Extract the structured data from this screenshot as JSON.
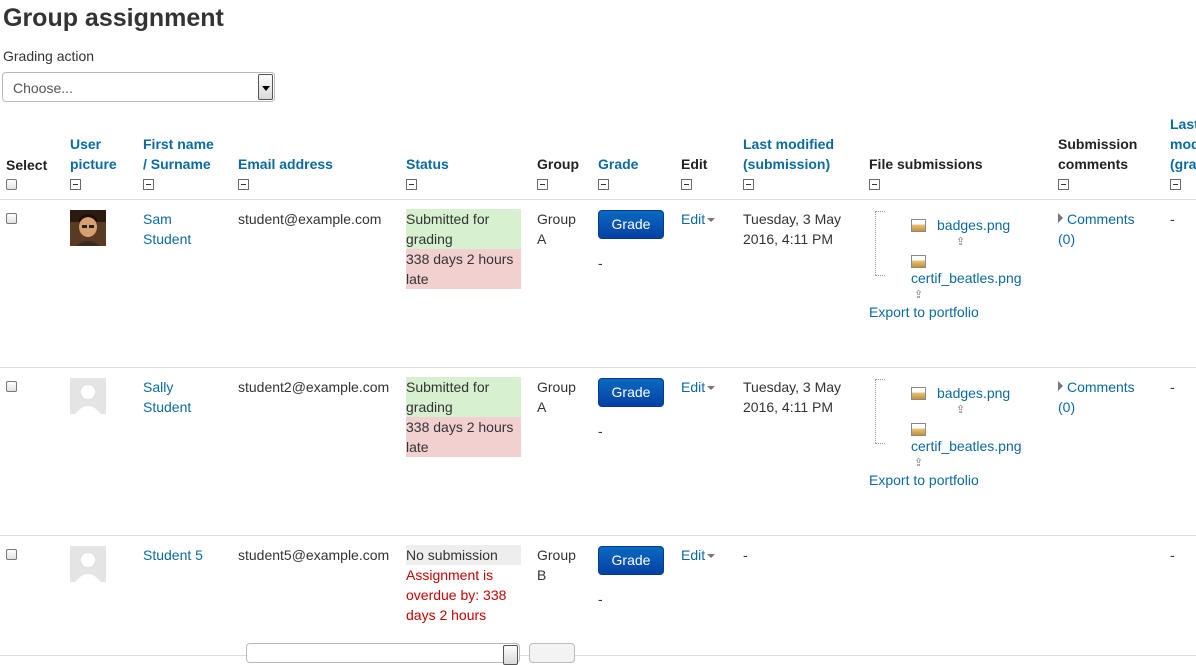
{
  "page": {
    "title": "Group assignment"
  },
  "grading_action": {
    "label": "Grading action",
    "selected": "Choose..."
  },
  "table": {
    "headers": {
      "select": "Select",
      "user_picture_1": "User",
      "user_picture_2": "picture",
      "first_name": "First name",
      "surname": "/ Surname",
      "email": "Email address",
      "status": "Status",
      "group": "Group",
      "grade": "Grade",
      "edit": "Edit",
      "last_modified_1": "Last modified",
      "last_modified_2": "(submission)",
      "file_submissions": "File submissions",
      "submission_comments_1": "Submission",
      "submission_comments_2": "comments",
      "last_modified_grade_1": "Last",
      "last_modified_grade_2": "mod",
      "last_modified_grade_3": "(gra"
    },
    "rows": [
      {
        "name_first": "Sam",
        "name_last": "Student",
        "email": "student@example.com",
        "status_1": "Submitted for",
        "status_2": "grading",
        "late_1": "338 days 2 hours",
        "late_2": "late",
        "group_1": "Group",
        "group_2": "A",
        "grade_button": "Grade",
        "grade_value": "-",
        "edit": "Edit",
        "modified_1": "Tuesday, 3 May",
        "modified_2": "2016, 4:11 PM",
        "file_1": "badges.png",
        "file_2": "certif_beatles.png",
        "export": "Export to portfolio",
        "comments": "Comments",
        "comments_count": "(0)",
        "last_grade": "-"
      },
      {
        "name_first": "Sally",
        "name_last": "Student",
        "email": "student2@example.com",
        "status_1": "Submitted for",
        "status_2": "grading",
        "late_1": "338 days 2 hours",
        "late_2": "late",
        "group_1": "Group",
        "group_2": "A",
        "grade_button": "Grade",
        "grade_value": "-",
        "edit": "Edit",
        "modified_1": "Tuesday, 3 May",
        "modified_2": "2016, 4:11 PM",
        "file_1": "badges.png",
        "file_2": "certif_beatles.png",
        "export": "Export to portfolio",
        "comments": "Comments",
        "comments_count": "(0)",
        "last_grade": "-"
      },
      {
        "name": "Student 5",
        "email": "student5@example.com",
        "status_1": "No submission",
        "overdue_1": "Assignment is",
        "overdue_2": "overdue by: 338",
        "overdue_3": "days 2 hours",
        "group_1": "Group",
        "group_2": "B",
        "grade_button": "Grade",
        "grade_value": "-",
        "edit": "Edit",
        "modified": "-",
        "last_grade": "-"
      }
    ]
  },
  "colors": {
    "link": "#0b6aa2",
    "submitted_bg": "#d6f0d0",
    "late_bg": "#f2d0d0",
    "overdue_text": "#cc0000",
    "grade_button": "#0a5bb8"
  },
  "icons": [
    "collapse-icon",
    "checkbox",
    "image-file-icon",
    "portfolio-icon",
    "dropdown-caret-icon",
    "expand-caret-icon",
    "avatar-photo",
    "avatar-placeholder"
  ]
}
